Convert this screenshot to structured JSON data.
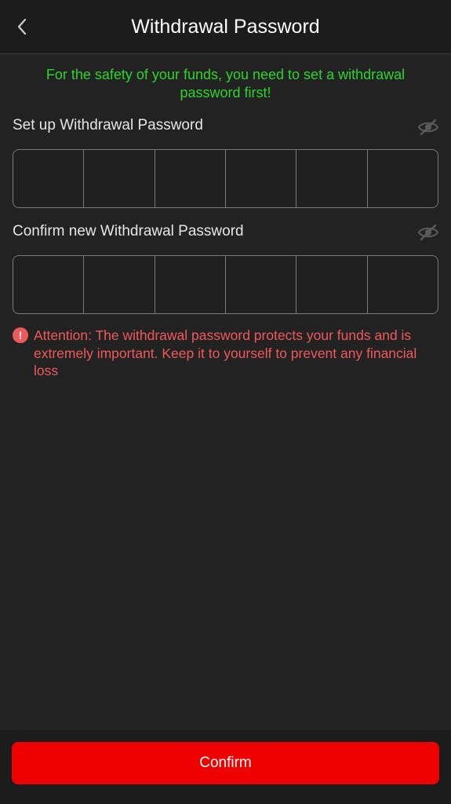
{
  "header": {
    "title": "Withdrawal Password",
    "back_icon": "chevron-left-icon"
  },
  "notice": "For the safety of your funds, you need to set a withdrawal password first!",
  "fields": [
    {
      "label": "Set up Withdrawal Password",
      "toggle_icon": "eye-off-icon",
      "digits": 6
    },
    {
      "label": "Confirm new Withdrawal Password",
      "toggle_icon": "eye-off-icon",
      "digits": 6
    }
  ],
  "attention": {
    "icon": "exclamation-icon",
    "icon_glyph": "!",
    "text": "Attention: The withdrawal password protects your funds and is extremely important. Keep it to yourself to prevent any financial loss"
  },
  "confirm_label": "Confirm",
  "colors": {
    "background": "#222222",
    "notice": "#2bd52b",
    "attention": "#f0595c",
    "primary_button": "#ee0000"
  }
}
